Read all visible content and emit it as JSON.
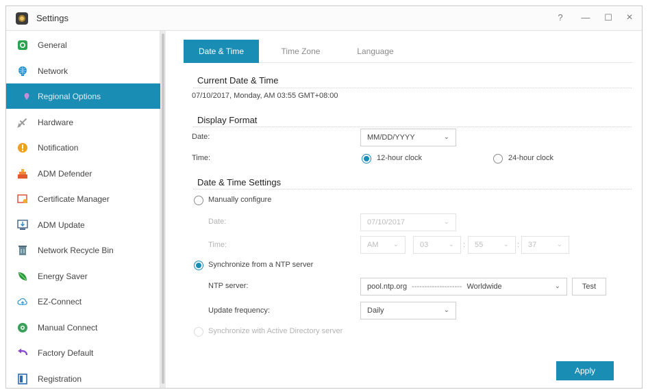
{
  "window": {
    "title": "Settings",
    "help": "?",
    "minimize": "—",
    "maximize": "☐",
    "close": "×"
  },
  "sidebar": {
    "items": [
      {
        "label": "General",
        "icon": "general-icon"
      },
      {
        "label": "Network",
        "icon": "network-icon"
      },
      {
        "label": "Regional Options",
        "icon": "regional-options-icon",
        "active": true
      },
      {
        "label": "Hardware",
        "icon": "hardware-icon"
      },
      {
        "label": "Notification",
        "icon": "notification-icon"
      },
      {
        "label": "ADM Defender",
        "icon": "adm-defender-icon"
      },
      {
        "label": "Certificate Manager",
        "icon": "certificate-icon"
      },
      {
        "label": "ADM Update",
        "icon": "adm-update-icon"
      },
      {
        "label": "Network Recycle Bin",
        "icon": "recycle-bin-icon"
      },
      {
        "label": "Energy Saver",
        "icon": "energy-saver-icon"
      },
      {
        "label": "EZ-Connect",
        "icon": "ez-connect-icon"
      },
      {
        "label": "Manual Connect",
        "icon": "manual-connect-icon"
      },
      {
        "label": "Factory Default",
        "icon": "factory-default-icon"
      },
      {
        "label": "Registration",
        "icon": "registration-icon"
      }
    ]
  },
  "tabs": [
    {
      "label": "Date & Time",
      "active": true
    },
    {
      "label": "Time Zone"
    },
    {
      "label": "Language"
    }
  ],
  "current": {
    "title": "Current Date & Time",
    "value": "07/10/2017, Monday, AM 03:55 GMT+08:00"
  },
  "display": {
    "title": "Display Format",
    "date_label": "Date:",
    "date_value": "MM/DD/YYYY",
    "time_label": "Time:",
    "clock12": "12-hour clock",
    "clock24": "24-hour clock",
    "selected_clock": "12-hour clock"
  },
  "settings": {
    "title": "Date & Time Settings",
    "manual_label": "Manually configure",
    "manual_date_label": "Date:",
    "manual_date_value": "07/10/2017",
    "manual_time_label": "Time:",
    "ampm": "AM",
    "hour": "03",
    "minute": "55",
    "second": "37",
    "colon": ":",
    "ntp_label": "Synchronize from a NTP server",
    "ntp_server_label": "NTP server:",
    "ntp_server_host": "pool.ntp.org",
    "ntp_server_dashes": "--------------------",
    "ntp_server_region": "Worldwide",
    "test_label": "Test",
    "update_label": "Update frequency:",
    "update_value": "Daily",
    "ad_label": "Synchronize with Active Directory server",
    "selected_mode": "ntp"
  },
  "apply_label": "Apply",
  "colors": {
    "accent": "#1a8db5",
    "active_nav_text": "#dfeff6",
    "disabled": "#b3b3b3"
  }
}
